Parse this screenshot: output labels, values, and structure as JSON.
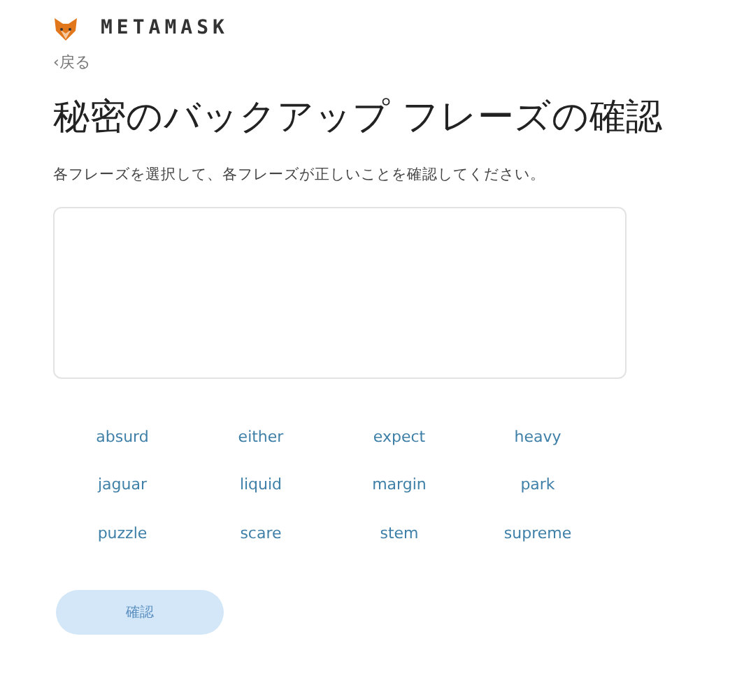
{
  "brand": "METAMASK",
  "back": "‹戻る",
  "title": "秘密のバックアップ フレーズの確認",
  "instruction": "各フレーズを選択して、各フレーズが正しいことを確認してください。",
  "words": [
    {
      "label": "absurd",
      "selected": false
    },
    {
      "label": "either",
      "selected": false
    },
    {
      "label": "expect",
      "selected": false
    },
    {
      "label": "heavy",
      "selected": false
    },
    {
      "label": "jaguar",
      "selected": false
    },
    {
      "label": "liquid",
      "selected": false
    },
    {
      "label": "margin",
      "selected": false
    },
    {
      "label": "park",
      "selected": false
    },
    {
      "label": "puzzle",
      "selected": false
    },
    {
      "label": "scare",
      "selected": false
    },
    {
      "label": "stem",
      "selected": false
    },
    {
      "label": "supreme",
      "selected": false
    }
  ],
  "confirm_button": {
    "label": "確認",
    "disabled": true
  }
}
